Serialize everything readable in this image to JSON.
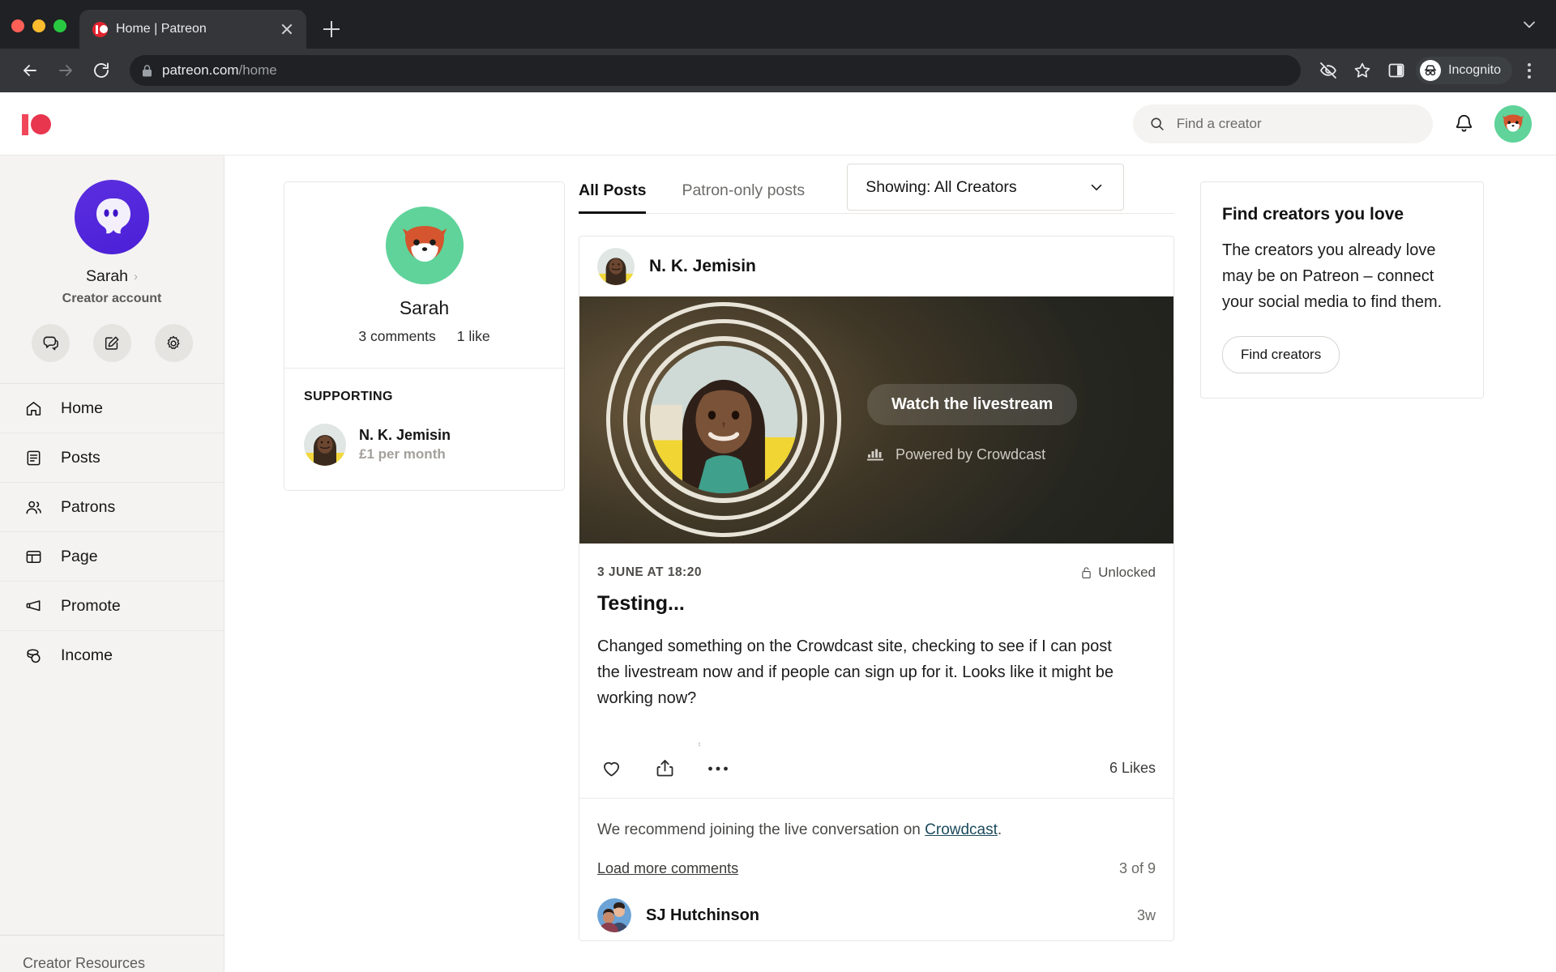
{
  "browser": {
    "tab": {
      "title": "Home | Patreon",
      "favicon": "patreon-favicon"
    },
    "new_tab_label": "+",
    "url_domain": "patreon.com",
    "url_path": "/home",
    "profile_label": "Incognito",
    "icons": {
      "back": "back-arrow-icon",
      "forward": "forward-arrow-icon",
      "reload": "reload-icon",
      "lock": "lock-icon",
      "tracking": "eye-off-icon",
      "bookmark": "star-icon",
      "sidepanel": "side-panel-icon",
      "menu": "three-dot-menu-icon",
      "tablist": "chevron-down-icon"
    }
  },
  "header": {
    "logo": "patreon-logo",
    "search": {
      "placeholder": "Find a creator",
      "value": ""
    },
    "notifications_icon": "bell-icon",
    "avatar": "fox-avatar"
  },
  "sidebar": {
    "profile": {
      "avatar": "ghost-avatar",
      "name": "Sarah",
      "chevron": "›",
      "role": "Creator account"
    },
    "quick_actions": [
      {
        "name": "messages-button",
        "icon": "chat-bubbles-icon"
      },
      {
        "name": "create-post-button",
        "icon": "pencil-square-icon"
      },
      {
        "name": "settings-button",
        "icon": "gear-icon"
      }
    ],
    "items": [
      {
        "label": "Home",
        "icon": "home-icon"
      },
      {
        "label": "Posts",
        "icon": "document-icon"
      },
      {
        "label": "Patrons",
        "icon": "people-icon"
      },
      {
        "label": "Page",
        "icon": "layout-icon"
      },
      {
        "label": "Promote",
        "icon": "megaphone-icon"
      },
      {
        "label": "Income",
        "icon": "coins-icon"
      }
    ],
    "footer_link": "Creator Resources"
  },
  "profile_card": {
    "avatar": "fox-avatar",
    "name": "Sarah",
    "comments": "3 comments",
    "likes": "1 like",
    "supporting_label": "SUPPORTING",
    "supporting": [
      {
        "name": "N. K. Jemisin",
        "tier": "£1 per month",
        "avatar": "creator-avatar"
      }
    ]
  },
  "feed": {
    "tabs": [
      {
        "label": "All Posts",
        "active": true
      },
      {
        "label": "Patron-only posts",
        "active": false
      }
    ],
    "filter": {
      "label": "Showing: All Creators",
      "chevron": "chevron-down-icon"
    },
    "post": {
      "author": "N. K. Jemisin",
      "author_avatar": "creator-avatar",
      "banner": {
        "watch_button": "Watch the livestream",
        "powered_by": "Powered by Crowdcast",
        "powered_icon": "crowdcast-icon"
      },
      "date": "3 JUNE AT 18:20",
      "lock_status": "Unlocked",
      "lock_icon": "unlocked-padlock-icon",
      "title": "Testing...",
      "text": "Changed something on the Crowdcast site, checking to see if I can post the livestream now and if people can sign up for it. Looks like it might be working now?",
      "actions": [
        {
          "name": "like-button",
          "icon": "heart-icon"
        },
        {
          "name": "share-button",
          "icon": "share-icon"
        },
        {
          "name": "more-options-button",
          "icon": "ellipsis-icon"
        }
      ],
      "likes": "6 Likes",
      "recommend_prefix": "We recommend joining the live conversation on ",
      "recommend_link": "Crowdcast",
      "recommend_suffix": ".",
      "load_more": "Load more comments",
      "comment_count": "3 of 9",
      "comments": [
        {
          "name": "SJ Hutchinson",
          "age": "3w",
          "avatar": "commenter-avatar"
        }
      ]
    }
  },
  "promo": {
    "title": "Find creators you love",
    "text": "The creators you already love may be on Patreon – connect your social media to find them.",
    "button": "Find creators"
  },
  "colors": {
    "patreon_red": "#e8364f",
    "sidebar_bg": "#f4f3f1",
    "green_avatar": "#5fd39a",
    "purple_avatar": "#4b1fd6",
    "browser_chrome": "#202124"
  }
}
